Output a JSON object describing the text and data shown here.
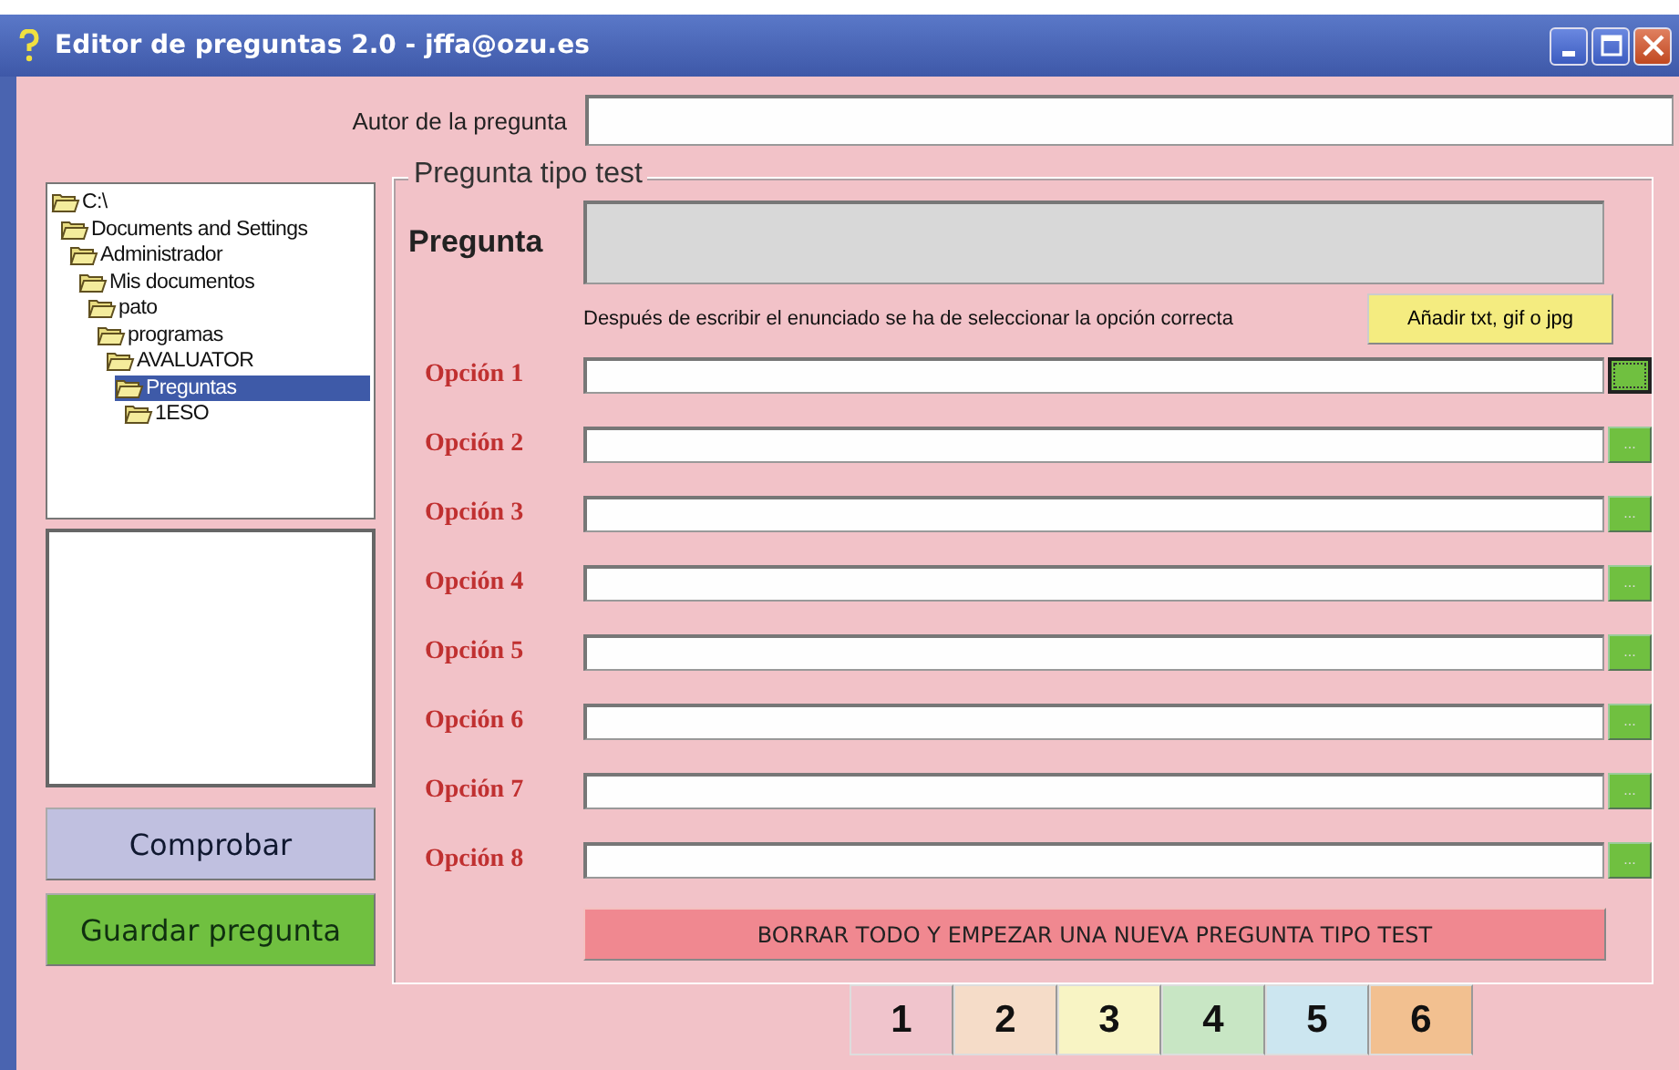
{
  "window": {
    "title": "Editor de preguntas 2.0 - jffa@ozu.es"
  },
  "author": {
    "label": "Autor de la pregunta"
  },
  "tree": [
    {
      "label": "C:\\",
      "selected": false,
      "children": [
        {
          "label": "Documents and Settings",
          "selected": false,
          "children": [
            {
              "label": "Administrador",
              "selected": false,
              "children": [
                {
                  "label": "Mis documentos",
                  "selected": false,
                  "children": [
                    {
                      "label": "pato",
                      "selected": false,
                      "children": [
                        {
                          "label": "programas",
                          "selected": false,
                          "children": [
                            {
                              "label": "AVALUATOR",
                              "selected": false,
                              "children": [
                                {
                                  "label": "Preguntas",
                                  "selected": true,
                                  "children": [
                                    {
                                      "label": "1ESO",
                                      "selected": false
                                    }
                                  ]
                                }
                              ]
                            }
                          ]
                        }
                      ]
                    }
                  ]
                }
              ]
            }
          ]
        }
      ]
    }
  ],
  "buttons": [
    {
      "label": "Comprobar",
      "kind": "check"
    },
    {
      "label": "Guardar pregunta",
      "kind": "save"
    }
  ],
  "group": {
    "title": "Pregunta tipo test",
    "question_label": "Pregunta",
    "hint": "Después de escribir el enunciado se ha de seleccionar la opción correcta",
    "attach_button": "Añadir txt, gif o jpg"
  },
  "options": [
    {
      "label": "Opción 1",
      "focused": true
    },
    {
      "label": "Opción 2",
      "focused": false,
      "button": "..."
    },
    {
      "label": "Opción 3",
      "focused": false,
      "button": "..."
    },
    {
      "label": "Opción 4",
      "focused": false,
      "button": "..."
    },
    {
      "label": "Opción 5",
      "focused": false,
      "button": "..."
    },
    {
      "label": "Opción 6",
      "focused": false,
      "button": "..."
    },
    {
      "label": "Opción 7",
      "focused": false,
      "button": "..."
    },
    {
      "label": "Opción 8",
      "focused": false,
      "button": "..."
    }
  ],
  "reset_button": "BORRAR TODO Y EMPEZAR UNA NUEVA PREGUNTA TIPO TEST",
  "pages": [
    {
      "label": "1",
      "color": "#f0c4cc"
    },
    {
      "label": "2",
      "color": "#f5dcc8"
    },
    {
      "label": "3",
      "color": "#f8f4c4"
    },
    {
      "label": "4",
      "color": "#c8e6c4"
    },
    {
      "label": "5",
      "color": "#cce6f0"
    },
    {
      "label": "6",
      "color": "#f2c090"
    }
  ]
}
